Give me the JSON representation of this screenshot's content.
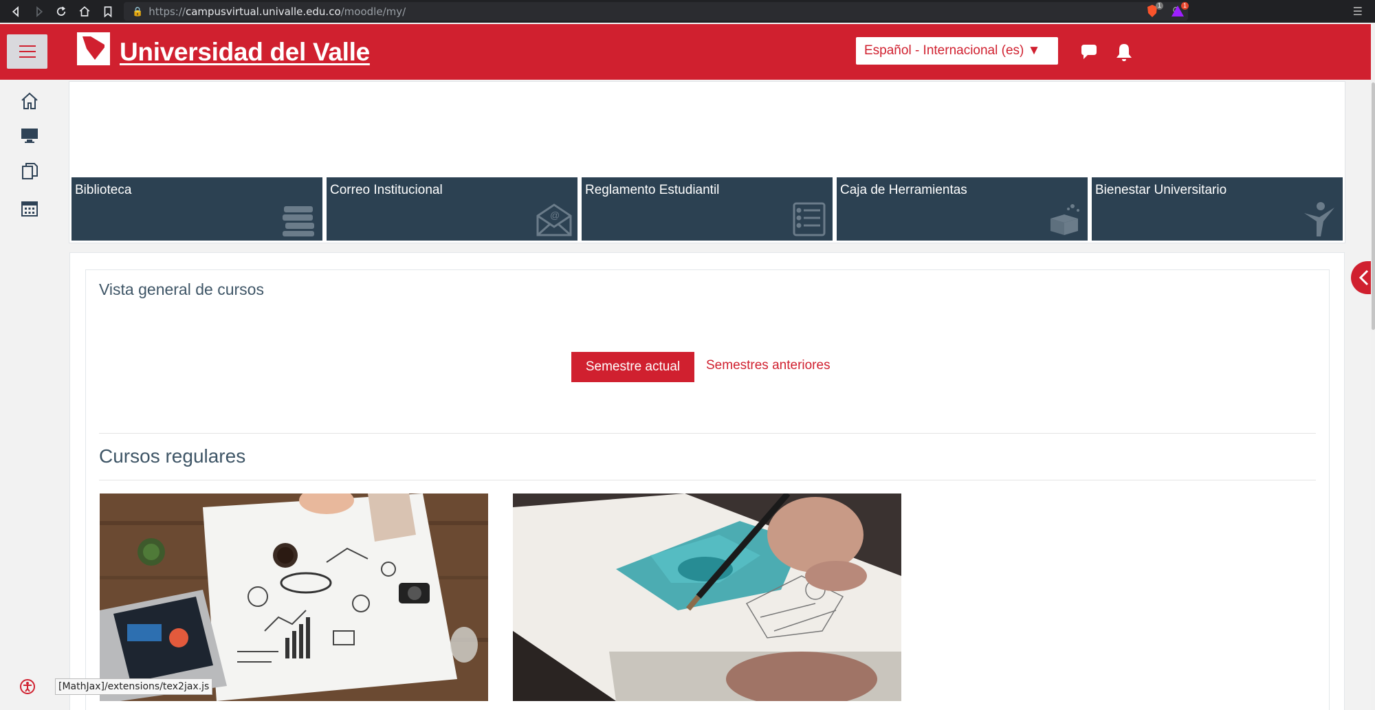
{
  "browser": {
    "url_prefix": "https://",
    "url_host": "campusvirtual.univalle.edu.co",
    "url_path": "/moodle/my/",
    "brave_badge": "1",
    "alert_badge": "1"
  },
  "header": {
    "brand": "Universidad del Valle",
    "language": "Español - Internacional (es) ▼"
  },
  "tiles": [
    {
      "label": "Biblioteca",
      "icon": "books-icon"
    },
    {
      "label": "Correo Institucional",
      "icon": "mail-icon"
    },
    {
      "label": "Reglamento Estudiantil",
      "icon": "list-icon"
    },
    {
      "label": "Caja de Herramientas",
      "icon": "toolbox-icon"
    },
    {
      "label": "Bienestar Universitario",
      "icon": "person-icon"
    }
  ],
  "overview": {
    "title": "Vista general de cursos",
    "tab_current": "Semestre actual",
    "tab_previous": "Semestres anteriores",
    "regular_title": "Cursos regulares"
  },
  "status_tip": "[MathJax]/extensions/tex2jax.js",
  "colors": {
    "brand_red": "#d0202f",
    "tile_navy": "#2c4152",
    "rail_icon": "#2e4256"
  }
}
